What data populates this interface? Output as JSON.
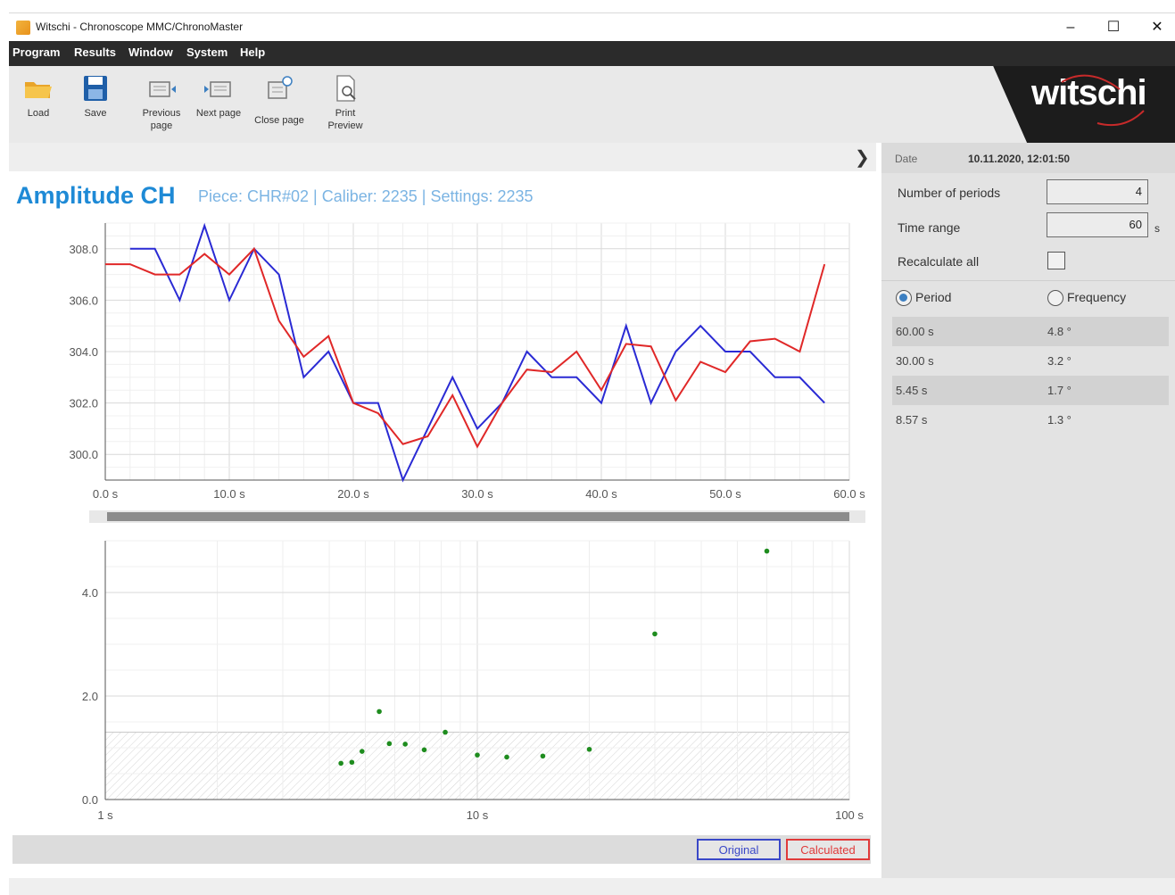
{
  "window": {
    "title": "Witschi - Chronoscope MMC/ChronoMaster",
    "minimize": "–",
    "maximize": "☐",
    "close": "✕"
  },
  "menu": [
    "Program",
    "Results",
    "Window",
    "System",
    "Help"
  ],
  "toolbar": {
    "load": "Load",
    "save": "Save",
    "previous_page_1": "Previous",
    "previous_page_2": "page",
    "next_page": "Next page",
    "close_page": "Close page",
    "print_preview_1": "Print",
    "print_preview_2": "Preview"
  },
  "brand": {
    "logo": "witschi"
  },
  "page": {
    "title": "Amplitude CH",
    "subtitle": "Piece: CHR#02 | Caliber: 2235 | Settings: 2235"
  },
  "legend": {
    "original": "Original",
    "calculated": "Calculated"
  },
  "right_panel": {
    "date_label": "Date",
    "date_value": "10.11.2020, 12:01:50",
    "num_periods_label": "Number of periods",
    "num_periods_value": "4",
    "time_range_label": "Time range",
    "time_range_value": "60",
    "time_range_unit": "s",
    "recalc_label": "Recalculate all",
    "recalc_checked": false,
    "radio_period": "Period",
    "radio_frequency": "Frequency",
    "selected_mode": "Period",
    "periods": [
      {
        "period": "60.00 s",
        "value": "4.8 °"
      },
      {
        "period": "30.00 s",
        "value": "3.2 °"
      },
      {
        "period": "5.45 s",
        "value": "1.7 °"
      },
      {
        "period": "8.57 s",
        "value": "1.3 °"
      }
    ]
  },
  "colors": {
    "original": "#2a2ad4",
    "calculated": "#e02828",
    "spectrum_points": "#1e8c1e",
    "title": "#1e8ad6"
  },
  "chart_data": [
    {
      "type": "line",
      "x_unit": "s",
      "xlim": [
        0,
        60
      ],
      "ylim": [
        299,
        309
      ],
      "x_ticks": [
        "0.0 s",
        "10.0 s",
        "20.0 s",
        "30.0 s",
        "40.0 s",
        "50.0 s",
        "60.0 s"
      ],
      "y_ticks": [
        "300.0",
        "302.0",
        "304.0",
        "306.0",
        "308.0"
      ],
      "grid": true,
      "x": [
        0,
        2,
        4,
        6,
        8,
        10,
        12,
        14,
        16,
        18,
        20,
        22,
        24,
        26,
        28,
        30,
        32,
        34,
        36,
        38,
        40,
        42,
        44,
        46,
        48,
        50,
        52,
        54,
        56,
        58,
        60
      ],
      "series": [
        {
          "name": "Original",
          "values": [
            null,
            308.0,
            308.0,
            306.0,
            308.9,
            306.0,
            308.0,
            307.0,
            303.0,
            304.0,
            302.0,
            302.0,
            299.0,
            301.0,
            303.0,
            301.0,
            302.0,
            304.0,
            303.0,
            303.0,
            302.0,
            305.0,
            302.0,
            304.0,
            305.0,
            304.0,
            304.0,
            303.0,
            303.0,
            302.0,
            null
          ]
        },
        {
          "name": "Calculated",
          "values": [
            307.4,
            307.4,
            307.0,
            307.0,
            307.8,
            307.0,
            308.0,
            305.2,
            303.8,
            304.6,
            302.0,
            301.6,
            300.4,
            300.7,
            302.3,
            300.3,
            302.0,
            303.3,
            303.2,
            304.0,
            302.5,
            304.3,
            304.2,
            302.1,
            303.6,
            303.2,
            304.4,
            304.5,
            304.0,
            307.4,
            null
          ]
        }
      ]
    },
    {
      "type": "scatter",
      "x_scale": "log",
      "xlim": [
        1,
        100
      ],
      "ylim": [
        0,
        5
      ],
      "x_ticks": [
        "1 s",
        "10 s",
        "100 s"
      ],
      "y_ticks": [
        "0.0",
        "2.0",
        "4.0"
      ],
      "grid": true,
      "threshold_band": [
        0,
        1.3
      ],
      "points": [
        {
          "x": 4.3,
          "y": 0.7
        },
        {
          "x": 4.6,
          "y": 0.72
        },
        {
          "x": 4.9,
          "y": 0.93
        },
        {
          "x": 5.45,
          "y": 1.7
        },
        {
          "x": 5.8,
          "y": 1.08
        },
        {
          "x": 6.4,
          "y": 1.07
        },
        {
          "x": 7.2,
          "y": 0.96
        },
        {
          "x": 8.2,
          "y": 1.3
        },
        {
          "x": 10.0,
          "y": 0.86
        },
        {
          "x": 12.0,
          "y": 0.82
        },
        {
          "x": 15.0,
          "y": 0.84
        },
        {
          "x": 20.0,
          "y": 0.97
        },
        {
          "x": 30.0,
          "y": 3.2
        },
        {
          "x": 60.0,
          "y": 4.8
        }
      ]
    }
  ]
}
